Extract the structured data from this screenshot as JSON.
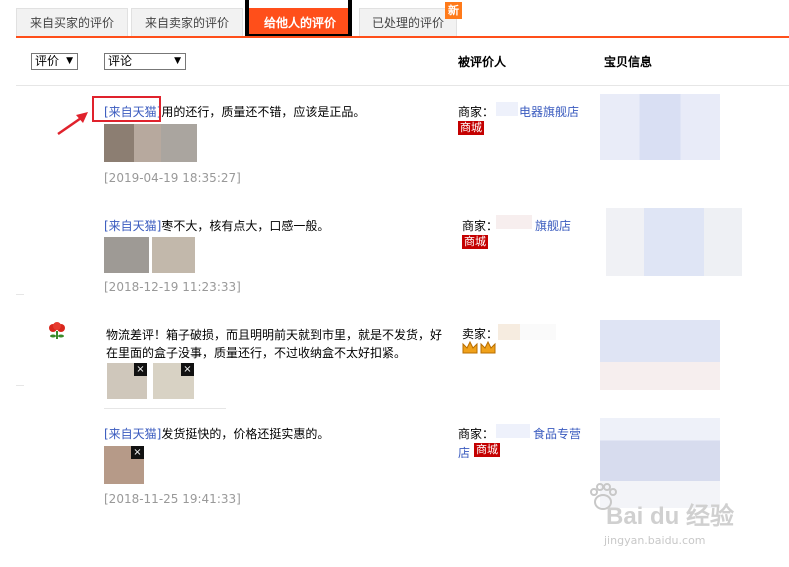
{
  "tabs": [
    {
      "label": "来自买家的评价"
    },
    {
      "label": "来自卖家的评价"
    },
    {
      "label": "给他人的评价"
    },
    {
      "label": "已处理的评价"
    }
  ],
  "new_badge": "新",
  "filters": {
    "rating": "评价",
    "comment": "评论"
  },
  "columns": {
    "rated_person": "被评价人",
    "item_info": "宝贝信息"
  },
  "reviews": [
    {
      "source": "[来自天猫]",
      "text": "用的还行，质量还不错，应该是正品。",
      "date": "[2019-04-19 18:35:27]",
      "merchant_label": "商家：",
      "shop": "电器旗舰店",
      "mall_tag": "商城"
    },
    {
      "source": "[来自天猫]",
      "text": "枣不大，核有点大，口感一般。",
      "date": "[2018-12-19 11:23:33]",
      "merchant_label": "商家：",
      "shop": "旗舰店",
      "mall_tag": "商城"
    },
    {
      "text_line1": "物流差评！箱子破损，而且明明前天就到市里，就是不发货，好",
      "text_line2": "在里面的盒子没事，质量还行，不过收纳盒不太好扣紧。",
      "merchant_label": "卖家：",
      "remove_label": "×"
    },
    {
      "source": "[来自天猫]",
      "text": "发货挺快的，价格还挺实惠的。",
      "date": "[2018-11-25 19:41:33]",
      "merchant_label": "商家：",
      "shop": "食品专营",
      "shop_line2": "店",
      "mall_tag": "商城",
      "remove_label": "×"
    }
  ],
  "watermark": {
    "brand": "Bai du 经验",
    "url": "jingyan.baidu.com"
  },
  "colors": {
    "accent": "#ff4f1a",
    "link": "#3a5bbf",
    "mall": "#c40000"
  }
}
